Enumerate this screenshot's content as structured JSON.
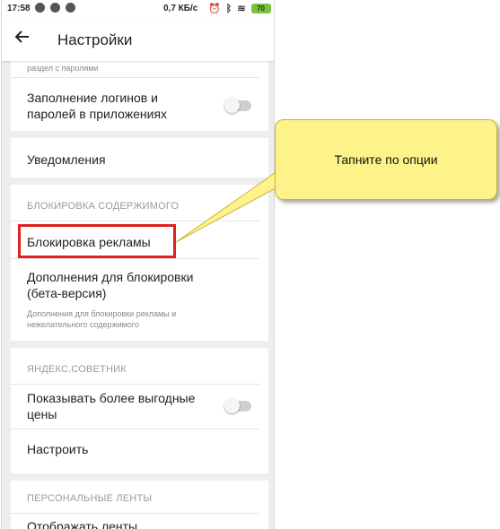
{
  "status_bar": {
    "time": "17:58",
    "speed": "0,7 КБ/с",
    "battery": "70"
  },
  "app_bar": {
    "back_icon": "arrow-left-icon",
    "title": "Настройки"
  },
  "settings": {
    "passwords_hint": "раздел с паролями",
    "autofill_apps_label": "Заполнение логинов и\nпаролей в приложениях",
    "autofill_apps_toggle": "off",
    "notifications_label": "Уведомления",
    "content_blocking_header": "БЛОКИРОВКА СОДЕРЖИМОГО",
    "ad_blocking_label": "Блокировка рекламы",
    "blocking_addons_label": "Дополнения для блокировки\n(бета-версия)",
    "blocking_addons_hint": "Дополнения для блокировки рекламы и\nнежелательного содержимого",
    "advisor_header": "ЯНДЕКС.СОВЕТНИК",
    "better_prices_label": "Показывать более выгодные\nцены",
    "better_prices_toggle": "off",
    "configure_label": "Настроить",
    "feeds_header": "ПЕРСОНАЛЬНЫЕ ЛЕНТЫ",
    "feeds_item_label": "Отображать ленты"
  },
  "annotation": {
    "callout_text": "Тапните по опции",
    "highlight_color": "#e02020",
    "callout_color": "#fdf38a"
  }
}
